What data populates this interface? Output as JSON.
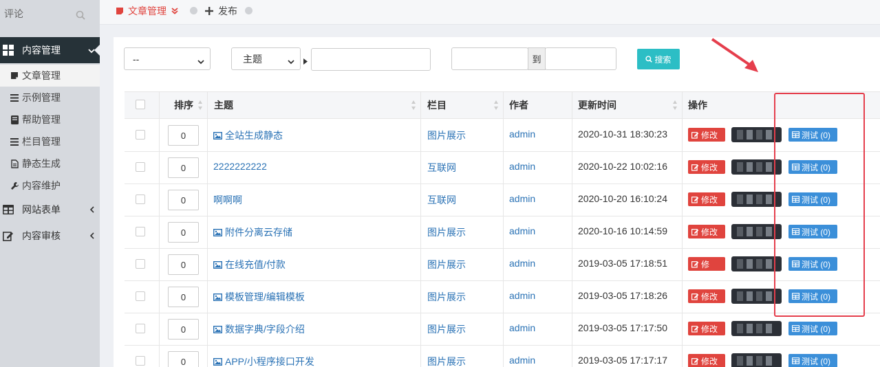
{
  "sidebar": {
    "search_placeholder": "评论",
    "groups": [
      {
        "label": "内容管理",
        "icon": "grid-icon",
        "active": true
      },
      {
        "label": "网站表单",
        "icon": "table-icon"
      },
      {
        "label": "内容审核",
        "icon": "edit-icon"
      }
    ],
    "items": [
      {
        "label": "文章管理",
        "icon": "note-icon"
      },
      {
        "label": "示例管理",
        "icon": "list-icon"
      },
      {
        "label": "帮助管理",
        "icon": "book-icon"
      },
      {
        "label": "栏目管理",
        "icon": "list-icon"
      },
      {
        "label": "静态生成",
        "icon": "file-icon"
      },
      {
        "label": "内容维护",
        "icon": "wrench-icon"
      }
    ]
  },
  "topbar": {
    "tabs": [
      {
        "label": "文章管理",
        "icon": "note-icon",
        "active": true
      },
      {
        "label": "发布",
        "icon": "plus-icon"
      }
    ]
  },
  "filters": {
    "category_value": "--",
    "field_value": "主题",
    "to_label": "到",
    "search_label": "搜索"
  },
  "table": {
    "headers": [
      "排序",
      "主题",
      "栏目",
      "作者",
      "更新时间",
      "操作"
    ],
    "rows": [
      {
        "order": "0",
        "title": "全站生成静态",
        "has_image_icon": true,
        "column": "图片展示",
        "author": "admin",
        "updated": "2020-10-31 18:30:23",
        "edit": "修改",
        "test": "测试 (0)"
      },
      {
        "order": "0",
        "title": "2222222222",
        "has_image_icon": false,
        "column": "互联网",
        "author": "admin",
        "updated": "2020-10-22 10:02:16",
        "edit": "修改",
        "test": "测试 (0)"
      },
      {
        "order": "0",
        "title": "啊啊啊",
        "has_image_icon": false,
        "column": "互联网",
        "author": "admin",
        "updated": "2020-10-20 16:10:24",
        "edit": "修改",
        "test": "测试 (0)"
      },
      {
        "order": "0",
        "title": "附件分离云存储",
        "has_image_icon": true,
        "column": "图片展示",
        "author": "admin",
        "updated": "2020-10-16 10:14:59",
        "edit": "修改",
        "test": "测试 (0)"
      },
      {
        "order": "0",
        "title": "在线充值/付款",
        "has_image_icon": true,
        "column": "图片展示",
        "author": "admin",
        "updated": "2019-03-05 17:18:51",
        "edit": "修",
        "test": "测试 (0)"
      },
      {
        "order": "0",
        "title": "模板管理/编辑模板",
        "has_image_icon": true,
        "column": "图片展示",
        "author": "admin",
        "updated": "2019-03-05 17:18:26",
        "edit": "修改",
        "test": "测试 (0)"
      },
      {
        "order": "0",
        "title": "数据字典/字段介绍",
        "has_image_icon": true,
        "column": "图片展示",
        "author": "admin",
        "updated": "2019-03-05 17:17:50",
        "edit": "修改",
        "test": "测试 (0)"
      },
      {
        "order": "0",
        "title": "APP/小程序接口开发",
        "has_image_icon": true,
        "column": "图片展示",
        "author": "admin",
        "updated": "2019-03-05 17:17:17",
        "edit": "修改",
        "test": "测试 (0)"
      }
    ]
  },
  "colors": {
    "sidebar_bg": "#d6d9de",
    "sidebar_active": "#263238",
    "accent_red": "#e0443e",
    "accent_blue": "#3b8fd9",
    "search_teal": "#2cbec5",
    "link": "#2a72b5"
  }
}
